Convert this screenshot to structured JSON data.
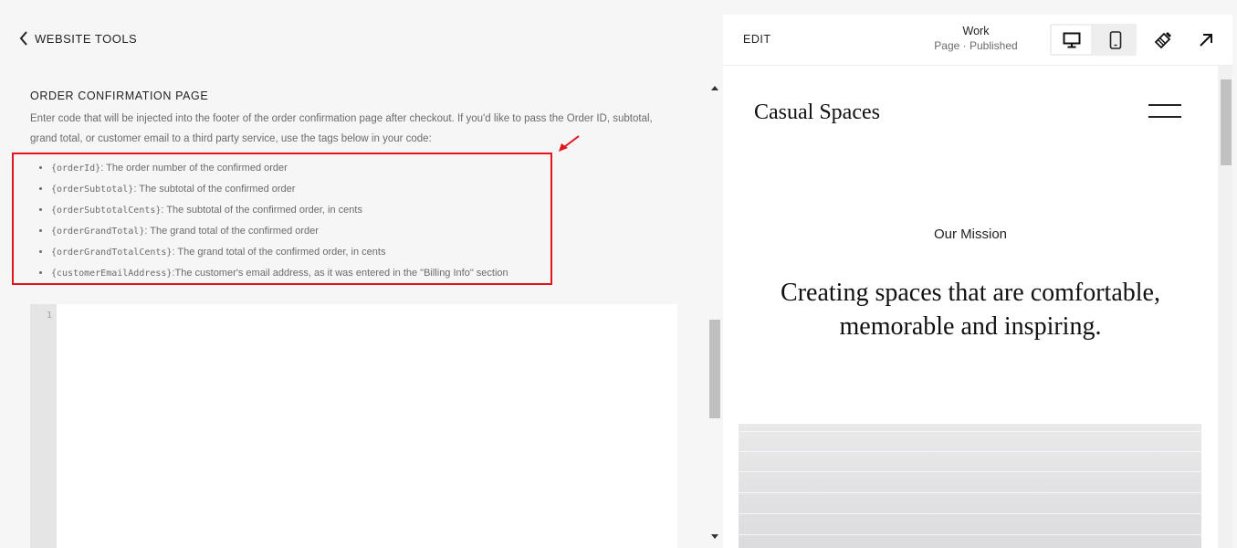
{
  "nav": {
    "back_label": "WEBSITE TOOLS"
  },
  "section": {
    "title": "ORDER CONFIRMATION PAGE",
    "description": "Enter code that will be injected into the footer of the order confirmation page after checkout. If you'd like to pass the Order ID, subtotal, grand total, or customer email to a third party service, use the tags below in your code:"
  },
  "tags": [
    {
      "code": "{orderId}",
      "text": ": The order number of the confirmed order"
    },
    {
      "code": "{orderSubtotal}",
      "text": ": The subtotal of the confirmed order"
    },
    {
      "code": "{orderSubtotalCents}",
      "text": ": The subtotal of the confirmed order, in cents"
    },
    {
      "code": "{orderGrandTotal}",
      "text": ": The grand total of the confirmed order"
    },
    {
      "code": "{orderGrandTotalCents}",
      "text": ": The grand total of the confirmed order, in cents"
    },
    {
      "code": "{customerEmailAddress}",
      "text": ":The customer's email address, as it was entered in the \"Billing Info\" section"
    }
  ],
  "editor": {
    "line_number": "1"
  },
  "colors": {
    "highlight": "#e0161c"
  },
  "preview_bar": {
    "edit_label": "EDIT",
    "page_name": "Work",
    "page_status": "Page · Published",
    "icons": [
      "desktop-icon",
      "mobile-icon",
      "paintbrush-icon",
      "external-arrow-icon"
    ]
  },
  "preview": {
    "site_title": "Casual Spaces",
    "mission_label": "Our Mission",
    "mission_text": "Creating spaces that are comfortable, memorable and inspiring."
  }
}
